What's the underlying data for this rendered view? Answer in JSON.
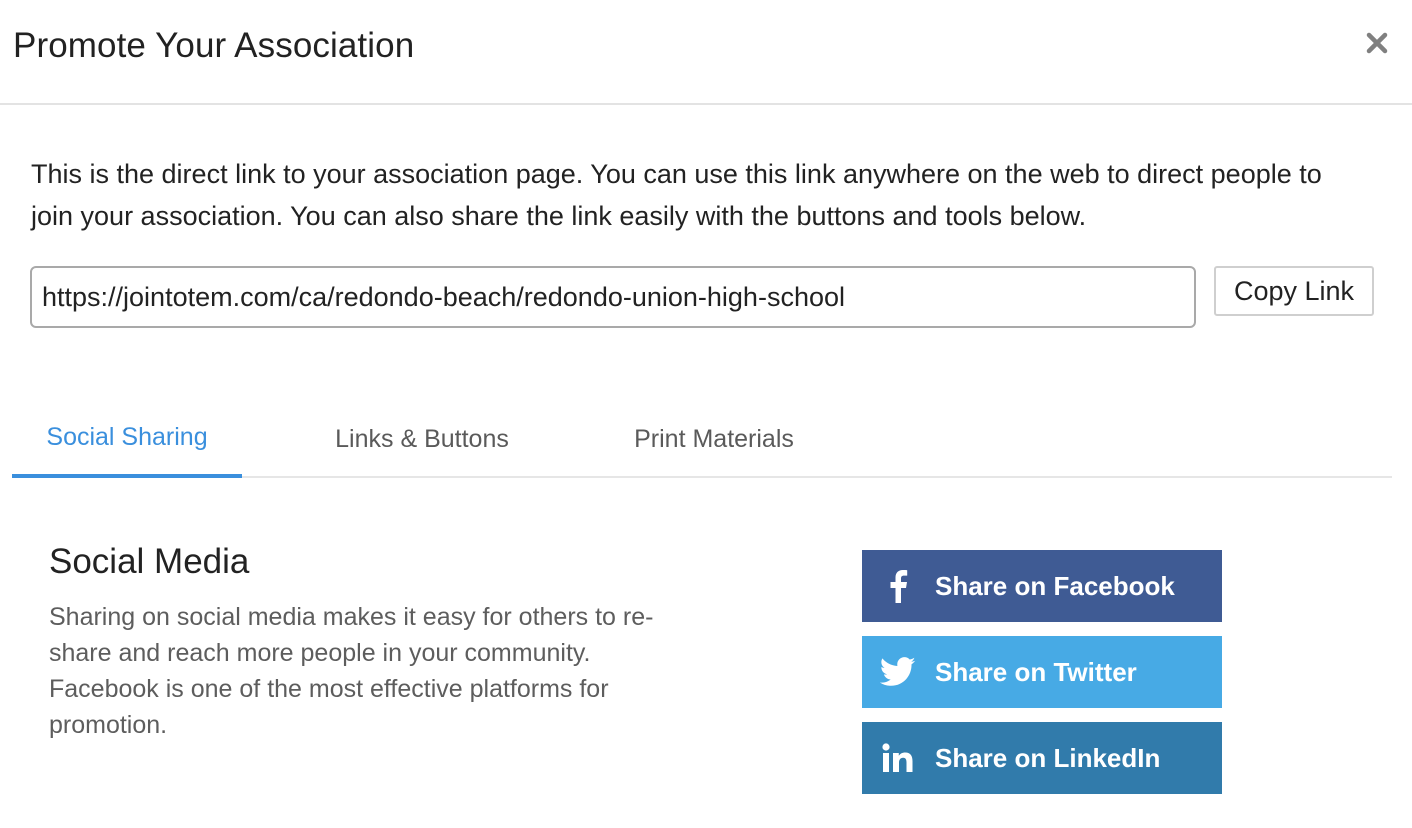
{
  "dialog": {
    "title": "Promote Your Association",
    "close_icon": "close-icon"
  },
  "intro": {
    "text": "This is the direct link to your association page. You can use this link anywhere on the web to direct people to join your association. You can also share the link easily with the buttons and tools below."
  },
  "link": {
    "value": "https://jointotem.com/ca/redondo-beach/redondo-union-high-school",
    "copy_label": "Copy Link"
  },
  "tabs": [
    {
      "label": "Social Sharing",
      "active": true
    },
    {
      "label": "Links & Buttons",
      "active": false
    },
    {
      "label": "Print Materials",
      "active": false
    }
  ],
  "social": {
    "title": "Social Media",
    "description": "Sharing on social media makes it easy for others to re-share and reach more people in your community. Facebook is one of the most effective platforms for promotion.",
    "buttons": [
      {
        "label": "Share on Facebook",
        "icon": "facebook-icon",
        "color": "#3f5b94"
      },
      {
        "label": "Share on Twitter",
        "icon": "twitter-icon",
        "color": "#47aae5"
      },
      {
        "label": "Share on LinkedIn",
        "icon": "linkedin-icon",
        "color": "#317bab"
      }
    ]
  },
  "colors": {
    "accent": "#3a8fdd"
  }
}
